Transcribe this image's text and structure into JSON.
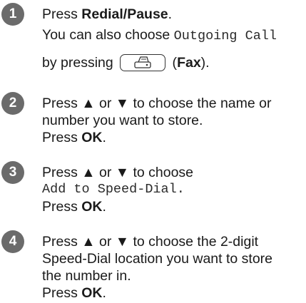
{
  "steps": [
    {
      "number": "1",
      "line1": {
        "prefix": "Press ",
        "bold": "Redial/Pause",
        "suffix": "."
      },
      "line2": {
        "text": "You can also choose ",
        "mono": "Outgoing Call"
      },
      "line3": {
        "prefix": "by pressing",
        "bold": "Fax",
        "bracket_open": " (",
        "bracket_close": ")."
      },
      "fax_key_icon": "fax-icon"
    },
    {
      "number": "2",
      "lines": [
        "Press ▲ or ▼ to choose the name or",
        "number you want to store."
      ],
      "press": "Press ",
      "ok": "OK",
      "period": "."
    },
    {
      "number": "3",
      "line1": "Press ▲ or ▼ to choose",
      "mono": "Add to Speed-Dial.",
      "press": "Press ",
      "ok": "OK",
      "period": "."
    },
    {
      "number": "4",
      "lines": [
        "Press ▲ or ▼ to choose the 2-digit",
        "Speed-Dial location you want to store",
        "the number in."
      ],
      "press": "Press ",
      "ok": "OK",
      "period": "."
    }
  ],
  "colors": {
    "badge": "#6b6b6b",
    "text": "#1a1a1a"
  }
}
